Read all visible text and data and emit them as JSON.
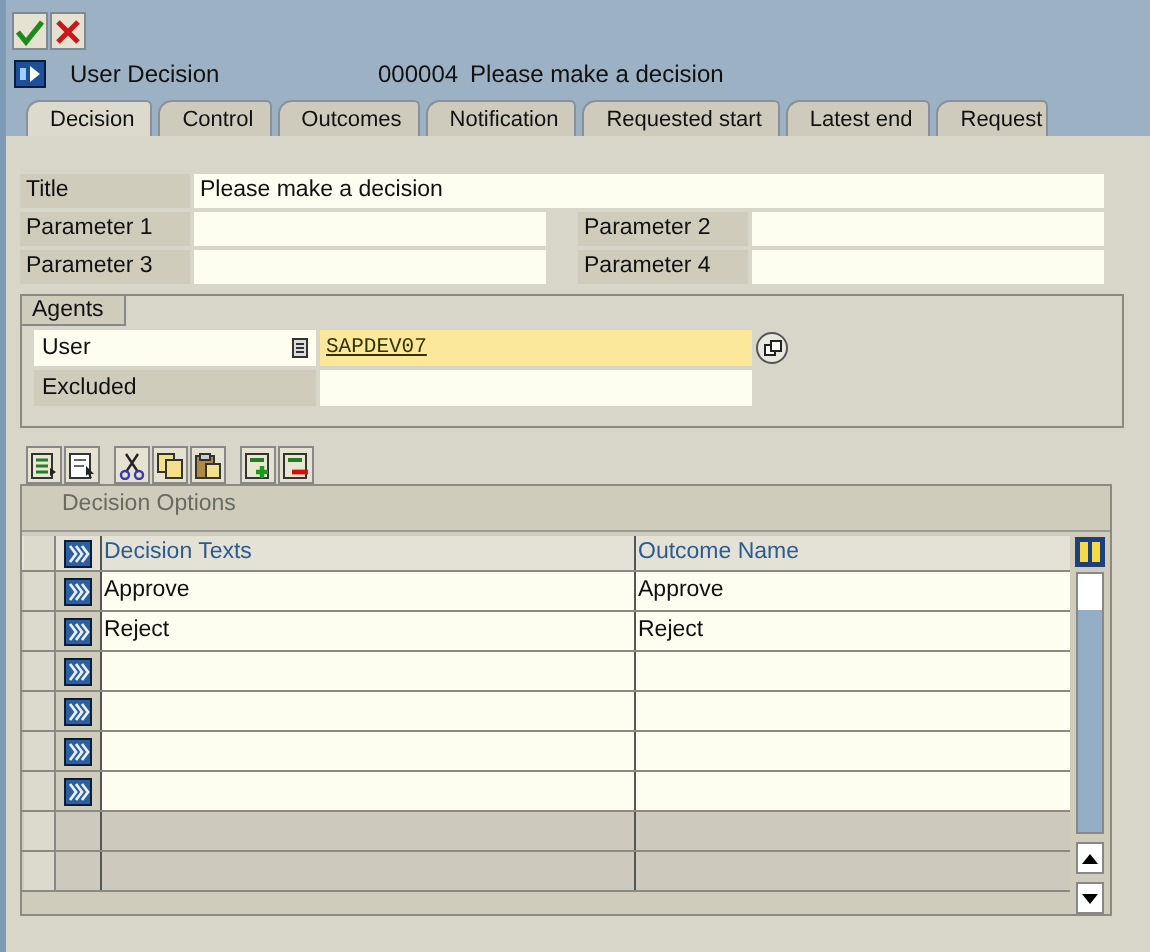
{
  "toolbar": {
    "buttons": [
      {
        "kind": "confirm"
      },
      {
        "kind": "cancel"
      }
    ]
  },
  "header": {
    "title": "User Decision",
    "number": "000004",
    "description": "Please make a decision"
  },
  "tabs": [
    {
      "label": "Decision",
      "selected": true
    },
    {
      "label": "Control",
      "selected": false
    },
    {
      "label": "Outcomes",
      "selected": false
    },
    {
      "label": "Notification",
      "selected": false
    },
    {
      "label": "Requested start",
      "selected": false
    },
    {
      "label": "Latest end",
      "selected": false
    },
    {
      "label": "Request",
      "selected": false
    }
  ],
  "form": {
    "title": {
      "label": "Title",
      "value": "Please make a decision"
    },
    "parameters": [
      {
        "label": "Parameter 1"
      },
      {
        "label": "Parameter 2"
      },
      {
        "label": "Parameter 3"
      },
      {
        "label": "Parameter 4"
      }
    ]
  },
  "agents": {
    "title": "Agents",
    "user": {
      "label": "User",
      "value": "SAPDEV07"
    },
    "excluded": {
      "label": "Excluded"
    }
  },
  "table_toolbar": [
    {
      "kind": "details"
    },
    {
      "kind": "select"
    },
    {
      "kind": "cut"
    },
    {
      "kind": "copy"
    },
    {
      "kind": "paste"
    },
    {
      "kind": "insert"
    },
    {
      "kind": "delete"
    }
  ],
  "table": {
    "title": "Decision Options",
    "columns": [
      "Decision Texts",
      "Outcome Name"
    ],
    "rows": [
      {
        "editable": true,
        "cells": [
          "Approve",
          "Approve"
        ]
      },
      {
        "editable": true,
        "cells": [
          "Reject",
          "Reject"
        ]
      },
      {
        "editable": true
      },
      {
        "editable": true
      },
      {
        "editable": true
      },
      {
        "editable": true
      },
      {
        "editable": false
      },
      {
        "editable": false
      }
    ]
  }
}
